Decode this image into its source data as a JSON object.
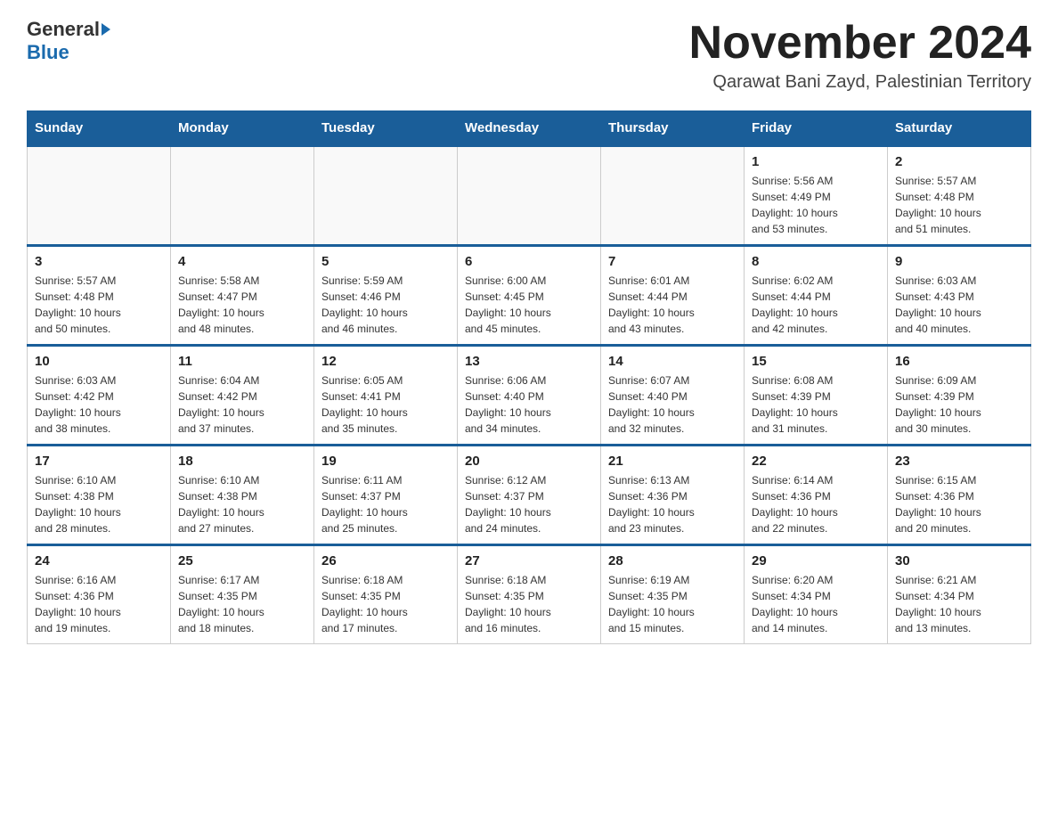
{
  "logo": {
    "general": "General",
    "blue": "Blue"
  },
  "title": "November 2024",
  "location": "Qarawat Bani Zayd, Palestinian Territory",
  "headers": [
    "Sunday",
    "Monday",
    "Tuesday",
    "Wednesday",
    "Thursday",
    "Friday",
    "Saturday"
  ],
  "weeks": [
    [
      {
        "day": "",
        "info": ""
      },
      {
        "day": "",
        "info": ""
      },
      {
        "day": "",
        "info": ""
      },
      {
        "day": "",
        "info": ""
      },
      {
        "day": "",
        "info": ""
      },
      {
        "day": "1",
        "info": "Sunrise: 5:56 AM\nSunset: 4:49 PM\nDaylight: 10 hours\nand 53 minutes."
      },
      {
        "day": "2",
        "info": "Sunrise: 5:57 AM\nSunset: 4:48 PM\nDaylight: 10 hours\nand 51 minutes."
      }
    ],
    [
      {
        "day": "3",
        "info": "Sunrise: 5:57 AM\nSunset: 4:48 PM\nDaylight: 10 hours\nand 50 minutes."
      },
      {
        "day": "4",
        "info": "Sunrise: 5:58 AM\nSunset: 4:47 PM\nDaylight: 10 hours\nand 48 minutes."
      },
      {
        "day": "5",
        "info": "Sunrise: 5:59 AM\nSunset: 4:46 PM\nDaylight: 10 hours\nand 46 minutes."
      },
      {
        "day": "6",
        "info": "Sunrise: 6:00 AM\nSunset: 4:45 PM\nDaylight: 10 hours\nand 45 minutes."
      },
      {
        "day": "7",
        "info": "Sunrise: 6:01 AM\nSunset: 4:44 PM\nDaylight: 10 hours\nand 43 minutes."
      },
      {
        "day": "8",
        "info": "Sunrise: 6:02 AM\nSunset: 4:44 PM\nDaylight: 10 hours\nand 42 minutes."
      },
      {
        "day": "9",
        "info": "Sunrise: 6:03 AM\nSunset: 4:43 PM\nDaylight: 10 hours\nand 40 minutes."
      }
    ],
    [
      {
        "day": "10",
        "info": "Sunrise: 6:03 AM\nSunset: 4:42 PM\nDaylight: 10 hours\nand 38 minutes."
      },
      {
        "day": "11",
        "info": "Sunrise: 6:04 AM\nSunset: 4:42 PM\nDaylight: 10 hours\nand 37 minutes."
      },
      {
        "day": "12",
        "info": "Sunrise: 6:05 AM\nSunset: 4:41 PM\nDaylight: 10 hours\nand 35 minutes."
      },
      {
        "day": "13",
        "info": "Sunrise: 6:06 AM\nSunset: 4:40 PM\nDaylight: 10 hours\nand 34 minutes."
      },
      {
        "day": "14",
        "info": "Sunrise: 6:07 AM\nSunset: 4:40 PM\nDaylight: 10 hours\nand 32 minutes."
      },
      {
        "day": "15",
        "info": "Sunrise: 6:08 AM\nSunset: 4:39 PM\nDaylight: 10 hours\nand 31 minutes."
      },
      {
        "day": "16",
        "info": "Sunrise: 6:09 AM\nSunset: 4:39 PM\nDaylight: 10 hours\nand 30 minutes."
      }
    ],
    [
      {
        "day": "17",
        "info": "Sunrise: 6:10 AM\nSunset: 4:38 PM\nDaylight: 10 hours\nand 28 minutes."
      },
      {
        "day": "18",
        "info": "Sunrise: 6:10 AM\nSunset: 4:38 PM\nDaylight: 10 hours\nand 27 minutes."
      },
      {
        "day": "19",
        "info": "Sunrise: 6:11 AM\nSunset: 4:37 PM\nDaylight: 10 hours\nand 25 minutes."
      },
      {
        "day": "20",
        "info": "Sunrise: 6:12 AM\nSunset: 4:37 PM\nDaylight: 10 hours\nand 24 minutes."
      },
      {
        "day": "21",
        "info": "Sunrise: 6:13 AM\nSunset: 4:36 PM\nDaylight: 10 hours\nand 23 minutes."
      },
      {
        "day": "22",
        "info": "Sunrise: 6:14 AM\nSunset: 4:36 PM\nDaylight: 10 hours\nand 22 minutes."
      },
      {
        "day": "23",
        "info": "Sunrise: 6:15 AM\nSunset: 4:36 PM\nDaylight: 10 hours\nand 20 minutes."
      }
    ],
    [
      {
        "day": "24",
        "info": "Sunrise: 6:16 AM\nSunset: 4:36 PM\nDaylight: 10 hours\nand 19 minutes."
      },
      {
        "day": "25",
        "info": "Sunrise: 6:17 AM\nSunset: 4:35 PM\nDaylight: 10 hours\nand 18 minutes."
      },
      {
        "day": "26",
        "info": "Sunrise: 6:18 AM\nSunset: 4:35 PM\nDaylight: 10 hours\nand 17 minutes."
      },
      {
        "day": "27",
        "info": "Sunrise: 6:18 AM\nSunset: 4:35 PM\nDaylight: 10 hours\nand 16 minutes."
      },
      {
        "day": "28",
        "info": "Sunrise: 6:19 AM\nSunset: 4:35 PM\nDaylight: 10 hours\nand 15 minutes."
      },
      {
        "day": "29",
        "info": "Sunrise: 6:20 AM\nSunset: 4:34 PM\nDaylight: 10 hours\nand 14 minutes."
      },
      {
        "day": "30",
        "info": "Sunrise: 6:21 AM\nSunset: 4:34 PM\nDaylight: 10 hours\nand 13 minutes."
      }
    ]
  ]
}
